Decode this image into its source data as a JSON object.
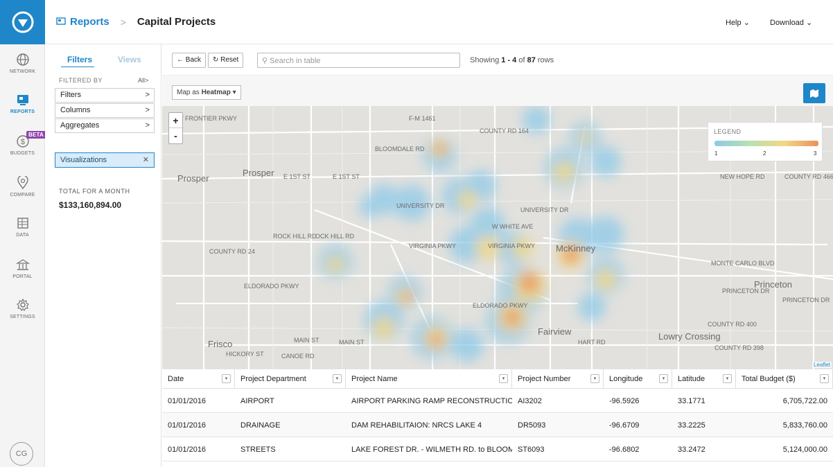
{
  "breadcrumb": {
    "root": "Reports",
    "current": "Capital Projects"
  },
  "top_menu": {
    "help": "Help",
    "download": "Download"
  },
  "rail": {
    "items": [
      {
        "label": "NETWORK"
      },
      {
        "label": "REPORTS"
      },
      {
        "label": "BUDGETS",
        "badge": "BETA"
      },
      {
        "label": "COMPARE"
      },
      {
        "label": "DATA"
      },
      {
        "label": "PORTAL"
      },
      {
        "label": "SETTINGS"
      }
    ],
    "avatar": "CG"
  },
  "filters_panel": {
    "tab_filters": "Filters",
    "tab_views": "Views",
    "filtered_by": "FILTERED BY",
    "filtered_all": "All",
    "rows": [
      "Filters",
      "Columns",
      "Aggregates"
    ],
    "visualizations": "Visualizations",
    "total_label": "TOTAL FOR A MONTH",
    "total_value": "$133,160,894.00"
  },
  "toolbar": {
    "back": "Back",
    "reset": "Reset",
    "search_placeholder": "Search in table",
    "showing_prefix": "Showing ",
    "showing_range": "1 - 4",
    "showing_mid": " of ",
    "showing_total": "87",
    "showing_suffix": " rows"
  },
  "map": {
    "map_as": "Map as ",
    "map_type": "Heatmap",
    "zoom_in": "+",
    "zoom_out": "-",
    "legend_title": "LEGEND",
    "legend_values": [
      "1",
      "2",
      "3"
    ],
    "attribution": "Leaflet",
    "labels": {
      "w_frontier": "W FRONTIER PKWY",
      "fm1461": "F-M 1461",
      "bloomdale": "BLOOMDALE RD",
      "county164": "COUNTY RD 164",
      "e1st_a": "E 1ST ST",
      "e1st_b": "E 1ST ST",
      "university": "UNIVERSITY DR",
      "university2": "UNIVERSITY DR",
      "w_white": "W WHITE AVE",
      "rockhill": "ROCK HILL RD",
      "rockhill2": "OCK HILL RD",
      "county24": "COUNTY RD 24",
      "virginia": "VIRGINIA PKWY",
      "virginia2": "VIRGINIA PKWY",
      "eldorado": "ELDORADO PKWY",
      "eldorado2": "ELDORADO PKWY",
      "mainst": "MAIN ST",
      "mainst2": "MAIN ST",
      "hickory": "HICKORY ST",
      "canoe": "CANOE RD",
      "hartrd": "HART RD",
      "newhope": "NEW HOPE RD",
      "county466": "COUNTY RD 466",
      "montecarlo": "MONTE CARLO BLVD",
      "princetondr": "PRINCETON DR",
      "princetondr2": "PRINCETON DR",
      "county400": "COUNTY RD 400",
      "county398": "COUNTY RD 398"
    },
    "cities": {
      "prosper": "Prosper",
      "prosper2": "Prosper",
      "mckinney": "McKinney",
      "fairview": "Fairview",
      "frisco": "Frisco",
      "lowry": "Lowry Crossing",
      "princeton": "Princeton"
    }
  },
  "table": {
    "headers": [
      "Date",
      "Project Department",
      "Project Name",
      "Project Number",
      "Longitude",
      "Latitude",
      "Total Budget ($)"
    ],
    "rows": [
      [
        "01/01/2016",
        "AIRPORT",
        "AIRPORT PARKING RAMP RECONSTRUCTION",
        "AI3202",
        "-96.5926",
        "33.1771",
        "6,705,722.00"
      ],
      [
        "01/01/2016",
        "DRAINAGE",
        "DAM REHABILITAION: NRCS LAKE 4",
        "DR5093",
        "-96.6709",
        "33.2225",
        "5,833,760.00"
      ],
      [
        "01/01/2016",
        "STREETS",
        "LAKE FOREST DR. - WILMETH RD. to BLOOM...",
        "ST6093",
        "-96.6802",
        "33.2472",
        "5,124,000.00"
      ]
    ]
  },
  "colors": {
    "accent": "#1f86c9",
    "beta": "#8e44ad",
    "heat_low": "#8ecae8",
    "heat_high": "#e9925a"
  }
}
